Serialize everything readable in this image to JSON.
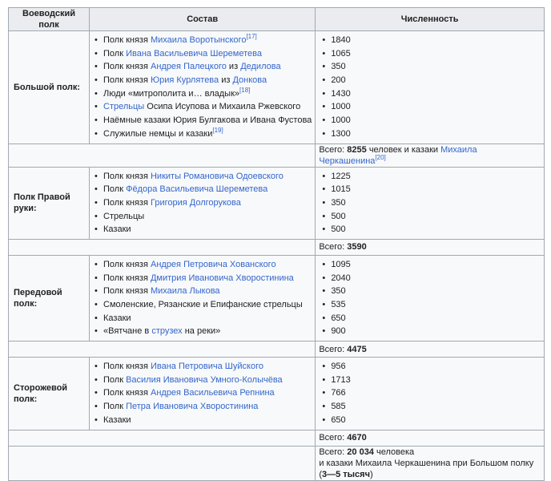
{
  "headers": [
    "Воеводский полк",
    "Состав",
    "Численность"
  ],
  "regiments": [
    {
      "name": "Большой полк:",
      "items": [
        {
          "parts": [
            {
              "t": "Полк князя "
            },
            {
              "t": "Михаила Воротынского",
              "link": true
            },
            {
              "t": "[17]",
              "sup": true
            }
          ]
        },
        {
          "parts": [
            {
              "t": "Полк "
            },
            {
              "t": "Ивана Васильевича Шереметева",
              "link": true
            }
          ]
        },
        {
          "parts": [
            {
              "t": "Полк князя "
            },
            {
              "t": "Андрея Палецкого",
              "link": true
            },
            {
              "t": " из "
            },
            {
              "t": "Дедилова",
              "link": true
            }
          ]
        },
        {
          "parts": [
            {
              "t": "Полк князя "
            },
            {
              "t": "Юрия Курлятева",
              "link": true
            },
            {
              "t": " из "
            },
            {
              "t": "Донкова",
              "link": true
            }
          ]
        },
        {
          "parts": [
            {
              "t": "Люди «митрополита и… владык»"
            },
            {
              "t": "[18]",
              "sup": true
            }
          ]
        },
        {
          "parts": [
            {
              "t": "Стрельцы",
              "link": true
            },
            {
              "t": " Осипа Исупова и Михаила Ржевского"
            }
          ]
        },
        {
          "parts": [
            {
              "t": "Наёмные казаки Юрия Булгакова и Ивана Фустова"
            }
          ]
        },
        {
          "parts": [
            {
              "t": "Служилые немцы и казаки"
            },
            {
              "t": "[19]",
              "sup": true
            }
          ]
        }
      ],
      "numbers": [
        "1840",
        "1065",
        "350",
        "200",
        "1430",
        "1000",
        "1000",
        "1300"
      ],
      "total": [
        {
          "t": "Всего: "
        },
        {
          "t": "8255",
          "b": true
        },
        {
          "t": " человек и казаки "
        },
        {
          "t": "Михаила Черкашенина",
          "link": true
        },
        {
          "t": "[20]",
          "sup": true
        }
      ]
    },
    {
      "name": "Полк Правой руки:",
      "items": [
        {
          "parts": [
            {
              "t": "Полк князя "
            },
            {
              "t": "Никиты Романовича Одоевского",
              "link": true
            }
          ]
        },
        {
          "parts": [
            {
              "t": "Полк "
            },
            {
              "t": "Фёдора Васильевича Шереметева",
              "link": true
            }
          ]
        },
        {
          "parts": [
            {
              "t": "Полк князя "
            },
            {
              "t": "Григория Долгорукова",
              "link": true
            }
          ]
        },
        {
          "parts": [
            {
              "t": "Стрельцы"
            }
          ]
        },
        {
          "parts": [
            {
              "t": "Казаки"
            }
          ]
        }
      ],
      "numbers": [
        "1225",
        "1015",
        "350",
        "500",
        "500"
      ],
      "total": [
        {
          "t": "Всего: "
        },
        {
          "t": "3590",
          "b": true
        }
      ]
    },
    {
      "name": "Передовой полк:",
      "items": [
        {
          "parts": [
            {
              "t": "Полк князя "
            },
            {
              "t": "Андрея Петровича Хованского",
              "link": true
            }
          ]
        },
        {
          "parts": [
            {
              "t": "Полк князя "
            },
            {
              "t": "Дмитрия Ивановича Хворостинина",
              "link": true
            }
          ]
        },
        {
          "parts": [
            {
              "t": "Полк князя "
            },
            {
              "t": "Михаила Лыкова",
              "link": true
            }
          ]
        },
        {
          "parts": [
            {
              "t": "Смоленские, Рязанские и Епифанские стрельцы"
            }
          ]
        },
        {
          "parts": [
            {
              "t": "Казаки"
            }
          ]
        },
        {
          "parts": [
            {
              "t": "«Вятчане в "
            },
            {
              "t": "струзех",
              "link": true
            },
            {
              "t": " на реки»"
            }
          ]
        }
      ],
      "numbers": [
        "1095",
        "2040",
        "350",
        "535",
        "650",
        "900"
      ],
      "total": [
        {
          "t": "Всего: "
        },
        {
          "t": "4475",
          "b": true
        }
      ]
    },
    {
      "name": "Сторожевой полк:",
      "items": [
        {
          "parts": [
            {
              "t": "Полк князя "
            },
            {
              "t": "Ивана Петровича Шуйского",
              "link": true
            }
          ]
        },
        {
          "parts": [
            {
              "t": "Полк "
            },
            {
              "t": "Василия Ивановича Умного-Колычёва",
              "link": true
            }
          ]
        },
        {
          "parts": [
            {
              "t": "Полк князя "
            },
            {
              "t": "Андрея Васильевича Репнина",
              "link": true
            }
          ]
        },
        {
          "parts": [
            {
              "t": "Полк "
            },
            {
              "t": "Петра Ивановича Хворостинина",
              "link": true
            }
          ]
        },
        {
          "parts": [
            {
              "t": "Казаки"
            }
          ]
        }
      ],
      "numbers": [
        "956",
        "1713",
        "766",
        "585",
        "650"
      ],
      "total": [
        {
          "t": "Всего: "
        },
        {
          "t": "4670",
          "b": true
        }
      ]
    }
  ],
  "grand_total": {
    "line1": [
      {
        "t": "Всего: "
      },
      {
        "t": "20 034",
        "b": true
      },
      {
        "t": " человека"
      }
    ],
    "line2": [
      {
        "t": "и казаки Михаила Черкашенина при Большом полку ("
      },
      {
        "t": "3—5 тысяч",
        "b": true
      },
      {
        "t": ")"
      }
    ]
  },
  "colors": {
    "link": "#3366cc",
    "header_bg": "#eaecf0",
    "cell_bg": "#f8f9fa",
    "border": "#a2a9b1",
    "text": "#202122"
  }
}
